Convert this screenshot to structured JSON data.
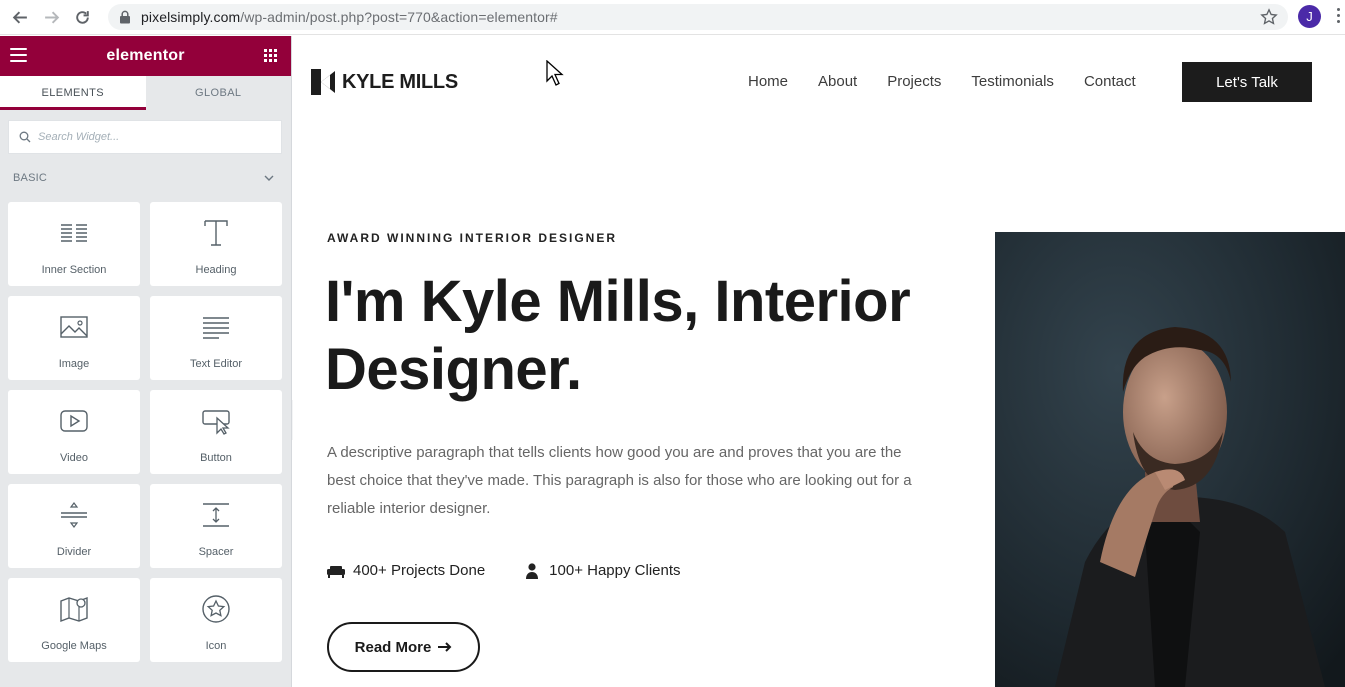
{
  "browser": {
    "url_host": "pixelsimply.com",
    "url_path": "/wp-admin/post.php?post=770&action=elementor#",
    "avatar_letter": "J"
  },
  "panel": {
    "brand": "elementor",
    "tabs": [
      "ELEMENTS",
      "GLOBAL"
    ],
    "search_placeholder": "Search Widget...",
    "category": "BASIC",
    "widgets": [
      {
        "label": "Inner Section",
        "icon": "inner-section-icon"
      },
      {
        "label": "Heading",
        "icon": "heading-icon"
      },
      {
        "label": "Image",
        "icon": "image-icon"
      },
      {
        "label": "Text Editor",
        "icon": "text-editor-icon"
      },
      {
        "label": "Video",
        "icon": "video-icon"
      },
      {
        "label": "Button",
        "icon": "button-icon"
      },
      {
        "label": "Divider",
        "icon": "divider-icon"
      },
      {
        "label": "Spacer",
        "icon": "spacer-icon"
      },
      {
        "label": "Google Maps",
        "icon": "google-maps-icon"
      },
      {
        "label": "Icon",
        "icon": "star-icon"
      }
    ]
  },
  "site": {
    "logo_text": "KYLE MILLS",
    "nav": [
      "Home",
      "About",
      "Projects",
      "Testimonials",
      "Contact"
    ],
    "cta": "Let's Talk",
    "eyebrow": "AWARD WINNING INTERIOR DESIGNER",
    "title": "I'm Kyle Mills, Interior Designer.",
    "description": "A descriptive paragraph that tells clients how good you are and proves that you are the best choice that they've made. This paragraph is also for those who are looking out for a reliable interior designer.",
    "stats": [
      {
        "icon": "sofa-icon",
        "text": "400+ Projects Done"
      },
      {
        "icon": "user-icon",
        "text": "100+ Happy Clients"
      }
    ],
    "read_more": "Read More"
  },
  "colors": {
    "elementor_brand": "#93003a",
    "cta_bg": "#1c1c1c"
  }
}
